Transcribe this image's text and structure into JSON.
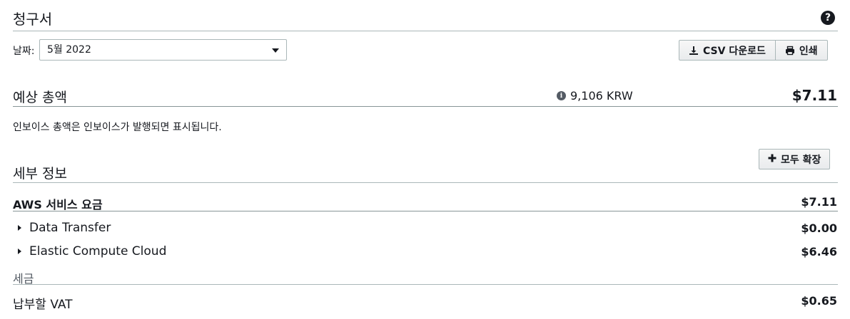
{
  "header": {
    "title": "청구서"
  },
  "filter": {
    "date_label": "날짜:",
    "date_value": "5월 2022"
  },
  "actions": {
    "csv_download": "CSV 다운로드",
    "print": "인쇄"
  },
  "estimate": {
    "title": "예상 총액",
    "krw_amount": "9,106 KRW",
    "usd_amount": "$7.11",
    "note": "인보이스 총액은 인보이스가 발행되면 표시됩니다."
  },
  "details": {
    "expand_all": "모두 확장",
    "title": "세부 정보",
    "service_charges": {
      "label": "AWS 서비스 요금",
      "amount": "$7.11"
    },
    "items": [
      {
        "label": "Data Transfer",
        "amount": "$0.00"
      },
      {
        "label": "Elastic Compute Cloud",
        "amount": "$6.46"
      }
    ],
    "tax": {
      "label": "세금",
      "vat_label": "납부할 VAT",
      "vat_amount": "$0.65"
    }
  }
}
